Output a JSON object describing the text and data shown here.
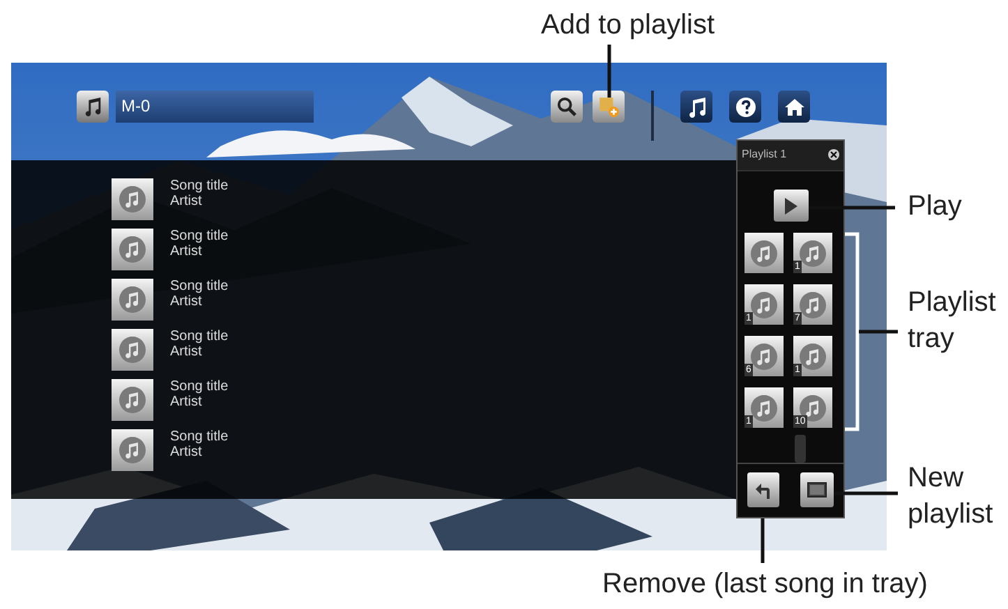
{
  "callouts": [
    {
      "text": "Add to playlist"
    },
    {
      "text": "Play"
    },
    {
      "text": "Playlist tray"
    },
    {
      "text": "New playlist"
    },
    {
      "text": "Remove (last song in tray)"
    }
  ],
  "header": {
    "title": "M-0"
  },
  "songs": [
    {
      "title": "Song title",
      "artist": "Artist"
    },
    {
      "title": "Song title",
      "artist": "Artist"
    },
    {
      "title": "Song title",
      "artist": "Artist"
    },
    {
      "title": "Song title",
      "artist": "Artist"
    },
    {
      "title": "Song title",
      "artist": "Artist"
    },
    {
      "title": "Song title",
      "artist": "Artist"
    }
  ],
  "playlist": {
    "title": "Playlist 1",
    "tray": [
      {
        "kind": "song"
      },
      {
        "kind": "song",
        "badge": "1"
      },
      {
        "kind": "song",
        "badge": "1"
      },
      {
        "kind": "song",
        "badge": "7"
      },
      {
        "kind": "song",
        "badge": "6"
      },
      {
        "kind": "song",
        "badge": "1"
      },
      {
        "kind": "song",
        "badge": "1"
      },
      {
        "kind": "song",
        "badge": "10"
      }
    ]
  }
}
